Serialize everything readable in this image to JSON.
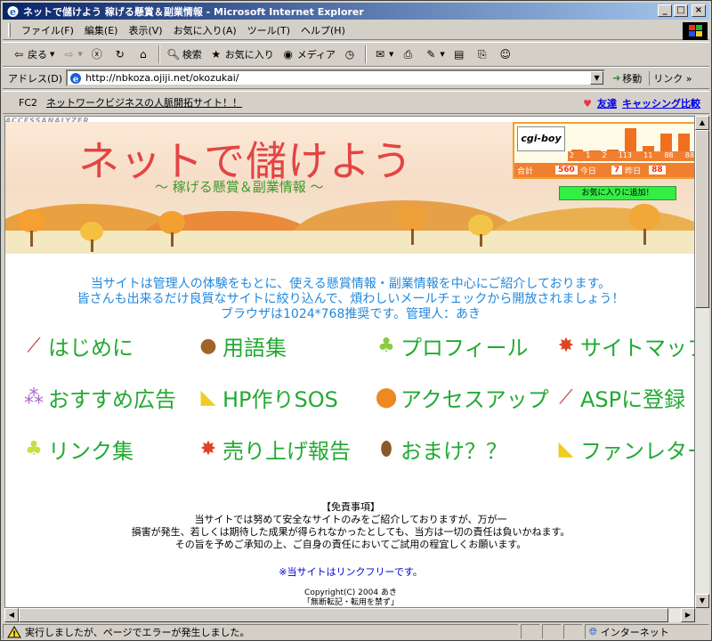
{
  "window": {
    "title": "ネットで儲けよう 稼げる懸賞＆副業情報 - Microsoft Internet Explorer",
    "buttons": [
      "_",
      "□",
      "×"
    ]
  },
  "menubar": {
    "items": [
      "ファイル(F)",
      "編集(E)",
      "表示(V)",
      "お気に入り(A)",
      "ツール(T)",
      "ヘルプ(H)"
    ]
  },
  "toolbar": {
    "back": "戻る",
    "search": "検索",
    "favorites": "お気に入り",
    "media": "メディア"
  },
  "address": {
    "label": "アドレス(D)",
    "url": "http://nbkoza.ojiji.net/okozukai/",
    "go": "移動",
    "links": "リンク"
  },
  "linkbar": {
    "fc2": "FC2",
    "fc2_link": "ネットワークビジネスの人脈開拓サイト！！",
    "friend": "友達",
    "cashing": "キャッシング比較"
  },
  "page": {
    "analyzer": "ACCESSANALYZER",
    "banner_title": "ネットで儲けよう",
    "banner_subtitle": "～ 稼げる懸賞＆副業情報 ～",
    "counter": {
      "logo": "cgi-boy",
      "daily": [
        "2",
        "1",
        "2",
        "113",
        "11",
        "88",
        "88"
      ],
      "daily_bars": [
        4,
        3,
        4,
        28,
        8,
        22,
        22
      ],
      "total_label": "合計",
      "total": "560",
      "today_label": "今日",
      "today": "7",
      "yesterday_label": "昨日",
      "yesterday": "88"
    },
    "fav_button": "お気に入りに追加！",
    "intro": [
      "当サイトは管理人の体験をもとに、使える懸賞情報・副業情報を中心にご紹介しております。",
      "皆さんも出来るだけ良質なサイトに絞り込んで、煩わしいメールチェックから開放されましょう！",
      "ブラウザは1024*768推奨です。管理人：あき"
    ],
    "nav": [
      {
        "label": "はじめに",
        "icon": "dragonfly-icon",
        "color": "#cc3333"
      },
      {
        "label": "用語集",
        "icon": "chestnut-icon",
        "color": "#a0642a"
      },
      {
        "label": "プロフィール",
        "icon": "tree-icon",
        "color": "#88cc44"
      },
      {
        "label": "サイトマップ",
        "icon": "maple-leaf-icon",
        "color": "#dd4422"
      },
      {
        "label": "おすすめ広告",
        "icon": "grapes-icon",
        "color": "#aa66cc"
      },
      {
        "label": "HP作りSOS",
        "icon": "ginkgo-icon",
        "color": "#eecc22"
      },
      {
        "label": "アクセスアップ",
        "icon": "persimmon-icon",
        "color": "#ee8822"
      },
      {
        "label": "ASPに登録",
        "icon": "dragonfly-icon",
        "color": "#cc3333"
      },
      {
        "label": "リンク集",
        "icon": "tree-icon",
        "color": "#ccdd44"
      },
      {
        "label": "売り上げ報告",
        "icon": "maple-leaf-icon",
        "color": "#dd4422"
      },
      {
        "label": "おまけ？？",
        "icon": "acorn-icon",
        "color": "#8a5a2a"
      },
      {
        "label": "ファンレター",
        "icon": "ginkgo-icon",
        "color": "#eecc22"
      }
    ],
    "disclaimer": [
      "【免責事項】",
      "当サイトでは努めて安全なサイトのみをご紹介しておりますが、万が一",
      "損害が発生、若しくは期待した成果が得られなかったとしても、当方は一切の責任は負いかねます。",
      "その旨を予めご承知の上、ご自身の責任においてご試用の程宜しくお願います。"
    ],
    "free_link": "※当サイトはリンクフリーです。",
    "copyright": [
      "Copyright(C) 2004 あき",
      "「無断転記・転用を禁ず」"
    ]
  },
  "status": {
    "message": "実行しましたが、ページでエラーが発生しました。",
    "zone": "インターネット"
  }
}
